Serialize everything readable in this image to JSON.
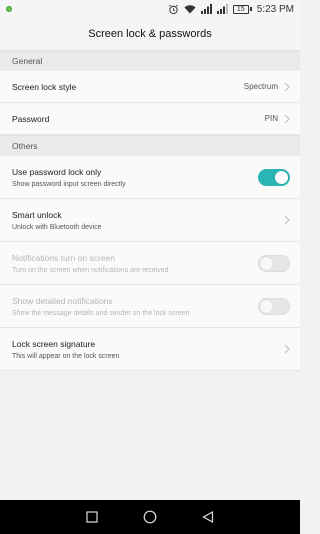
{
  "status_bar": {
    "time": "5:23 PM",
    "battery_level": "15",
    "icons": [
      "notification-dot-icon",
      "alarm-icon",
      "wifi-icon",
      "signal-icon",
      "signal-icon",
      "battery-icon"
    ]
  },
  "header": {
    "title": "Screen lock & passwords"
  },
  "sections": {
    "general": {
      "label": "General",
      "items": [
        {
          "title": "Screen lock style",
          "value": "Spectrum"
        },
        {
          "title": "Password",
          "value": "PIN"
        }
      ]
    },
    "others": {
      "label": "Others",
      "items": [
        {
          "title": "Use password lock only",
          "subtitle": "Show password input screen directly",
          "toggle": "on"
        },
        {
          "title": "Smart unlock",
          "subtitle": "Unlock with Bluetooth device"
        },
        {
          "title": "Notifications turn on screen",
          "subtitle": "Turn on the screen when notifications are received",
          "toggle": "off",
          "disabled": true
        },
        {
          "title": "Show detailed notifications",
          "subtitle": "Show the message details and sender on the lock screen",
          "toggle": "off",
          "disabled": true
        },
        {
          "title": "Lock screen signature",
          "subtitle": "This will appear on the lock screen"
        }
      ]
    }
  },
  "nav_bar": {
    "icons": [
      "recents-square-icon",
      "home-circle-icon",
      "back-triangle-icon"
    ]
  },
  "colors": {
    "accent": "#28b5b4",
    "background": "#f2f2f2",
    "navbar": "#000000"
  }
}
